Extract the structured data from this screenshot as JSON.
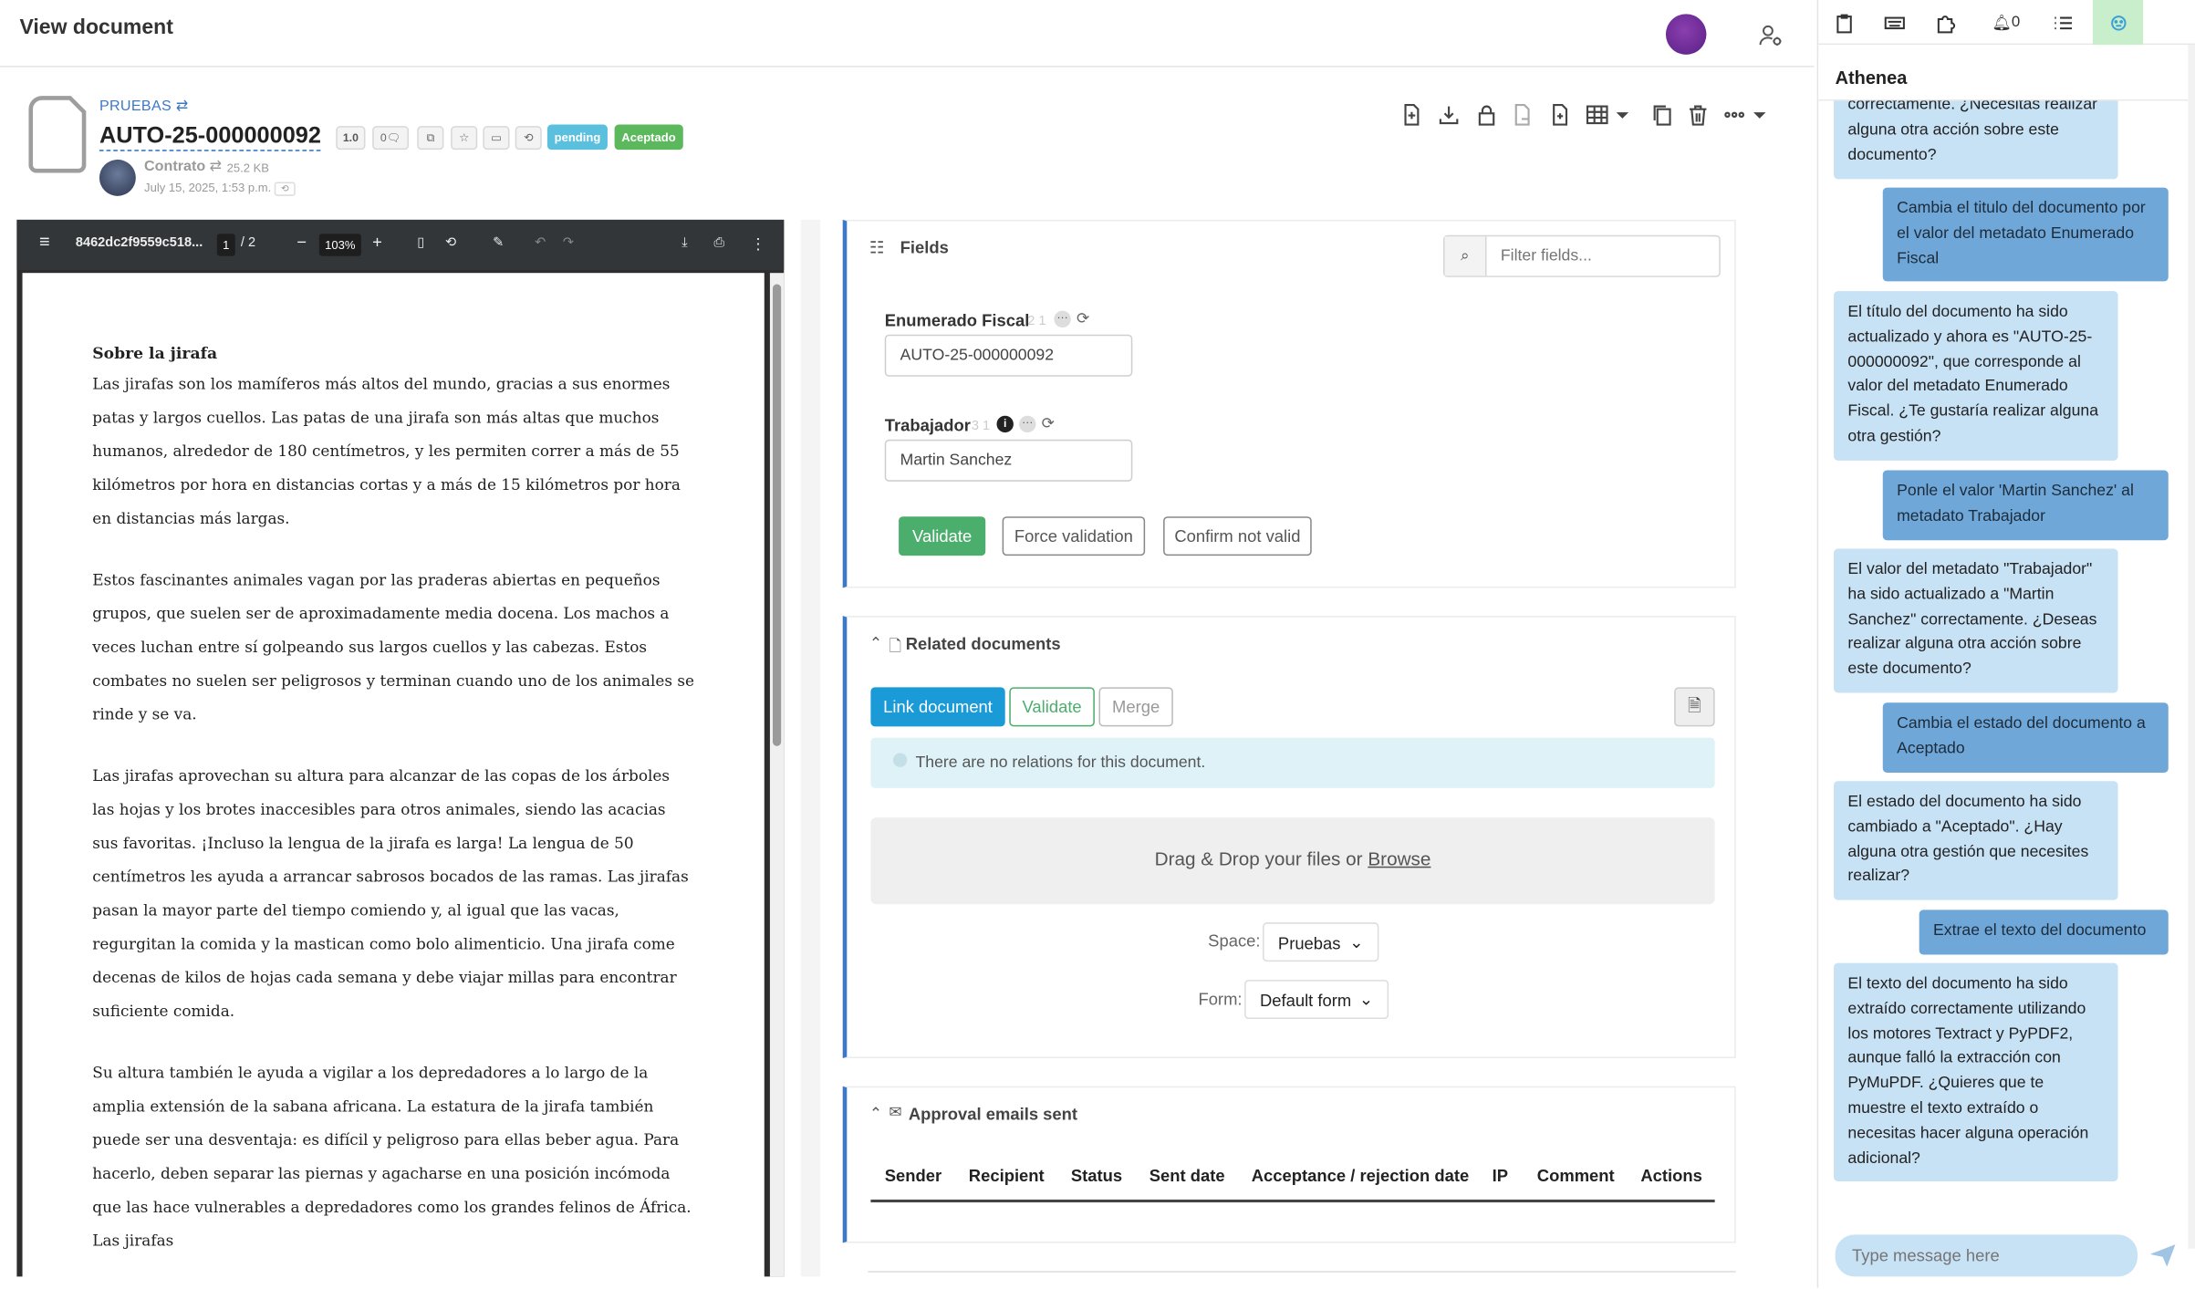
{
  "topbar": {
    "title": "View document"
  },
  "document": {
    "space": "PRUEBAS",
    "title": "AUTO-25-000000092",
    "version": "1.0",
    "comments": "0",
    "status_pending": "pending",
    "status_accepted": "Aceptado",
    "type": "Contrato",
    "size": "25.2 KB",
    "date": "July 15, 2025, 1:53 p.m."
  },
  "viewer": {
    "filename": "8462dc2f9559c518...",
    "page_current": "1",
    "page_total": "/ 2",
    "zoom": "103%",
    "heading": "Sobre la jirafa",
    "paragraphs": [
      "Las jirafas son los mamíferos más altos del mundo, gracias a sus enormes patas y largos cuellos. Las patas de una jirafa son más altas que muchos humanos, alrededor de 180 centímetros, y les permiten correr a más de 55 kilómetros por hora en distancias cortas y a más de 15 kilómetros por hora en distancias más largas.",
      "Estos fascinantes animales vagan por las praderas abiertas en pequeños grupos, que suelen ser de aproximadamente media docena. Los machos a veces luchan entre sí golpeando sus largos cuellos y las cabezas. Estos combates no suelen ser peligrosos y terminan cuando uno de los animales se rinde y se va.",
      "Las jirafas aprovechan su altura para alcanzar de las copas de los árboles las hojas y los brotes inaccesibles para otros animales, siendo las acacias sus favoritas. ¡Incluso la lengua de la jirafa es larga! La lengua de 50 centímetros les ayuda a arrancar sabrosos bocados de las ramas. Las jirafas pasan la mayor parte del tiempo comiendo y, al igual que las vacas, regurgitan la comida y la mastican como bolo alimenticio. Una jirafa come decenas de kilos de hojas cada semana y debe viajar millas para encontrar suficiente comida.",
      "Su altura también le ayuda a vigilar a los depredadores a lo largo de la amplia extensión de la sabana africana. La estatura de la jirafa también puede ser una desventaja: es difícil y peligroso para ellas beber agua. Para hacerlo, deben separar las piernas y agacharse en una posición incómoda que las hace vulnerables a depredadores como los grandes felinos de África. Las jirafas"
    ]
  },
  "fields": {
    "title": "Fields",
    "filter_placeholder": "Filter fields...",
    "field1_label": "Enumerado Fiscal",
    "field1_meta": "2 1",
    "field1_value": "AUTO-25-000000092",
    "field2_label": "Trabajador",
    "field2_meta": "3 1",
    "field2_value": "Martin Sanchez",
    "validate": "Validate",
    "force_validation": "Force validation",
    "confirm_not_valid": "Confirm not valid"
  },
  "related": {
    "title": "Related documents",
    "link": "Link document",
    "validate": "Validate",
    "merge": "Merge",
    "info": "There are no relations for this document.",
    "drop_text": "Drag & Drop your files or",
    "browse": "Browse",
    "space_label": "Space:",
    "space_value": "Pruebas",
    "form_label": "Form:",
    "form_value": "Default form"
  },
  "approval": {
    "title": "Approval emails sent",
    "columns": [
      "Sender",
      "Recipient",
      "Status",
      "Sent date",
      "Acceptance / rejection date",
      "IP",
      "Comment",
      "Actions"
    ]
  },
  "chat": {
    "notifications": "0",
    "title": "Athenea",
    "input_placeholder": "Type message here",
    "messages": [
      "correctamente. ¿Necesitas realizar alguna otra acción sobre este documento?",
      "Cambia el titulo del documento por el valor del metadato Enumerado Fiscal",
      "El título del documento ha sido actualizado y ahora es \"AUTO-25-000000092\", que corresponde al valor del metadato Enumerado Fiscal. ¿Te gustaría realizar alguna otra gestión?",
      "Ponle el valor 'Martin Sanchez' al metadato Trabajador",
      "El valor del metadato \"Trabajador\" ha sido actualizado a \"Martin Sanchez\" correctamente. ¿Deseas realizar alguna otra acción sobre este documento?",
      "Cambia el estado del documento a Aceptado",
      "El estado del documento ha sido cambiado a \"Aceptado\". ¿Hay alguna otra gestión que necesites realizar?",
      "Extrae el texto del documento",
      "El texto del documento ha sido extraído correctamente utilizando los motores Textract y PyPDF2, aunque falló la extracción con PyMuPDF. ¿Quieres que te muestre el texto extraído o necesitas hacer alguna operación adicional?"
    ]
  },
  "colors": {
    "accent": "#3d78c7",
    "pending": "#5bc0de",
    "accepted": "#5cb85c",
    "validate": "#4cae6c",
    "link": "#1a9ad6",
    "user_bubble": "#6fa8d8",
    "bot_bubble": "#c7e1f5"
  }
}
